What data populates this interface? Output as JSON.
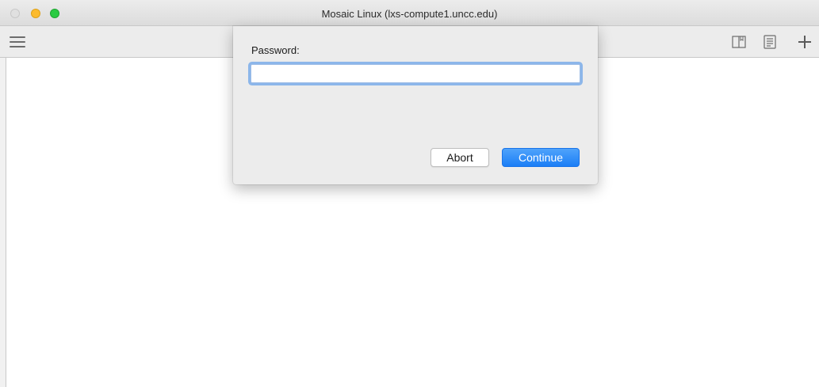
{
  "window": {
    "title": "Mosaic Linux (lxs-compute1.uncc.edu)"
  },
  "toolbar": {
    "icons": [
      "menu-icon",
      "bookmark-icon",
      "notes-icon",
      "plus-icon"
    ]
  },
  "dialog": {
    "password_label": "Password:",
    "password_value": "",
    "abort_label": "Abort",
    "continue_label": "Continue"
  },
  "colors": {
    "accent": "#1b7ef6",
    "focus_ring": "#8cb6ea"
  }
}
